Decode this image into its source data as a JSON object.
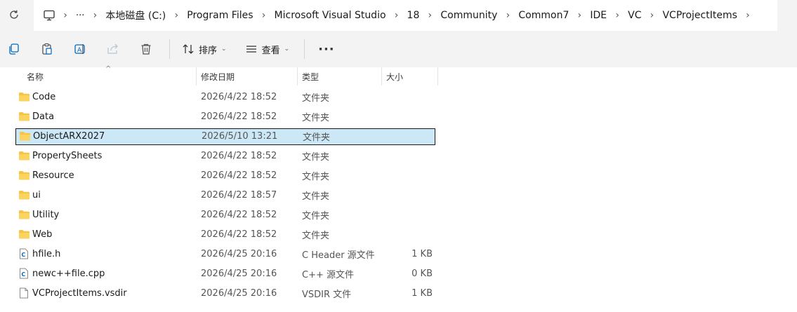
{
  "breadcrumb": {
    "more": "···",
    "items": [
      "本地磁盘 (C:)",
      "Program Files",
      "Microsoft Visual Studio",
      "18",
      "Community",
      "Common7",
      "IDE",
      "VC",
      "VCProjectItems"
    ]
  },
  "toolbar": {
    "sort_label": "排序",
    "view_label": "查看",
    "more": "···"
  },
  "columns": {
    "name": "名称",
    "date": "修改日期",
    "type": "类型",
    "size": "大小"
  },
  "files": [
    {
      "name": "Code",
      "date": "2026/4/22 18:52",
      "type": "文件夹",
      "size": "",
      "icon": "folder-icon"
    },
    {
      "name": "Data",
      "date": "2026/4/22 18:52",
      "type": "文件夹",
      "size": "",
      "icon": "folder-icon"
    },
    {
      "name": "ObjectARX2027",
      "date": "2026/5/10 13:21",
      "type": "文件夹",
      "size": "",
      "icon": "folder-icon",
      "selected": true
    },
    {
      "name": "PropertySheets",
      "date": "2026/4/22 18:52",
      "type": "文件夹",
      "size": "",
      "icon": "folder-icon"
    },
    {
      "name": "Resource",
      "date": "2026/4/22 18:52",
      "type": "文件夹",
      "size": "",
      "icon": "folder-icon"
    },
    {
      "name": "ui",
      "date": "2026/4/22 18:57",
      "type": "文件夹",
      "size": "",
      "icon": "folder-icon"
    },
    {
      "name": "Utility",
      "date": "2026/4/22 18:52",
      "type": "文件夹",
      "size": "",
      "icon": "folder-icon"
    },
    {
      "name": "Web",
      "date": "2026/4/22 18:52",
      "type": "文件夹",
      "size": "",
      "icon": "folder-icon"
    },
    {
      "name": "hfile.h",
      "date": "2026/4/25 20:16",
      "type": "C Header 源文件",
      "size": "1 KB",
      "icon": "c-header-file-icon"
    },
    {
      "name": "newc++file.cpp",
      "date": "2026/4/25 20:16",
      "type": "C++ 源文件",
      "size": "0 KB",
      "icon": "cpp-source-file-icon"
    },
    {
      "name": "VCProjectItems.vsdir",
      "date": "2026/4/25 20:16",
      "type": "VSDIR 文件",
      "size": "1 KB",
      "icon": "generic-file-icon"
    }
  ],
  "colors": {
    "selection_bg": "#cce8f7",
    "folder": "#f5c445",
    "accent": "#0067c0"
  }
}
